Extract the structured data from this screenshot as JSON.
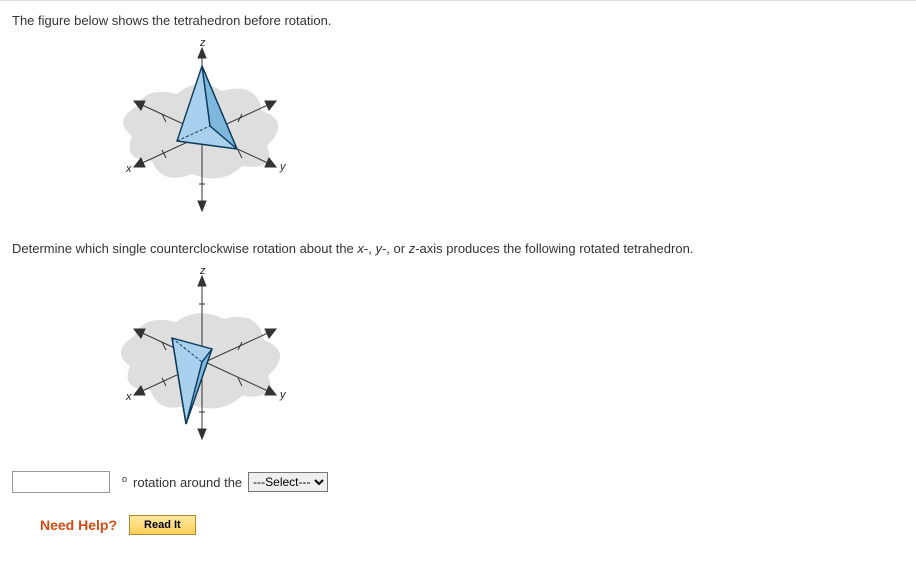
{
  "intro_text": "The figure below shows the tetrahedron before rotation.",
  "question_text_prefix": "Determine which single counterclockwise rotation about the ",
  "question_text_suffix": "-axis produces the following rotated tetrahedron.",
  "axis_x": "x",
  "axis_y": "y",
  "axis_z": "z",
  "sep1": "-, ",
  "sep2": "-, or ",
  "answer": {
    "degree_symbol": "o",
    "middle_text": " rotation around the ",
    "select_placeholder": "---Select---",
    "input_value": ""
  },
  "help": {
    "label": "Need Help?",
    "read_button": "Read It"
  },
  "figure": {
    "labels": {
      "x": "x",
      "y": "y",
      "z": "z"
    }
  }
}
